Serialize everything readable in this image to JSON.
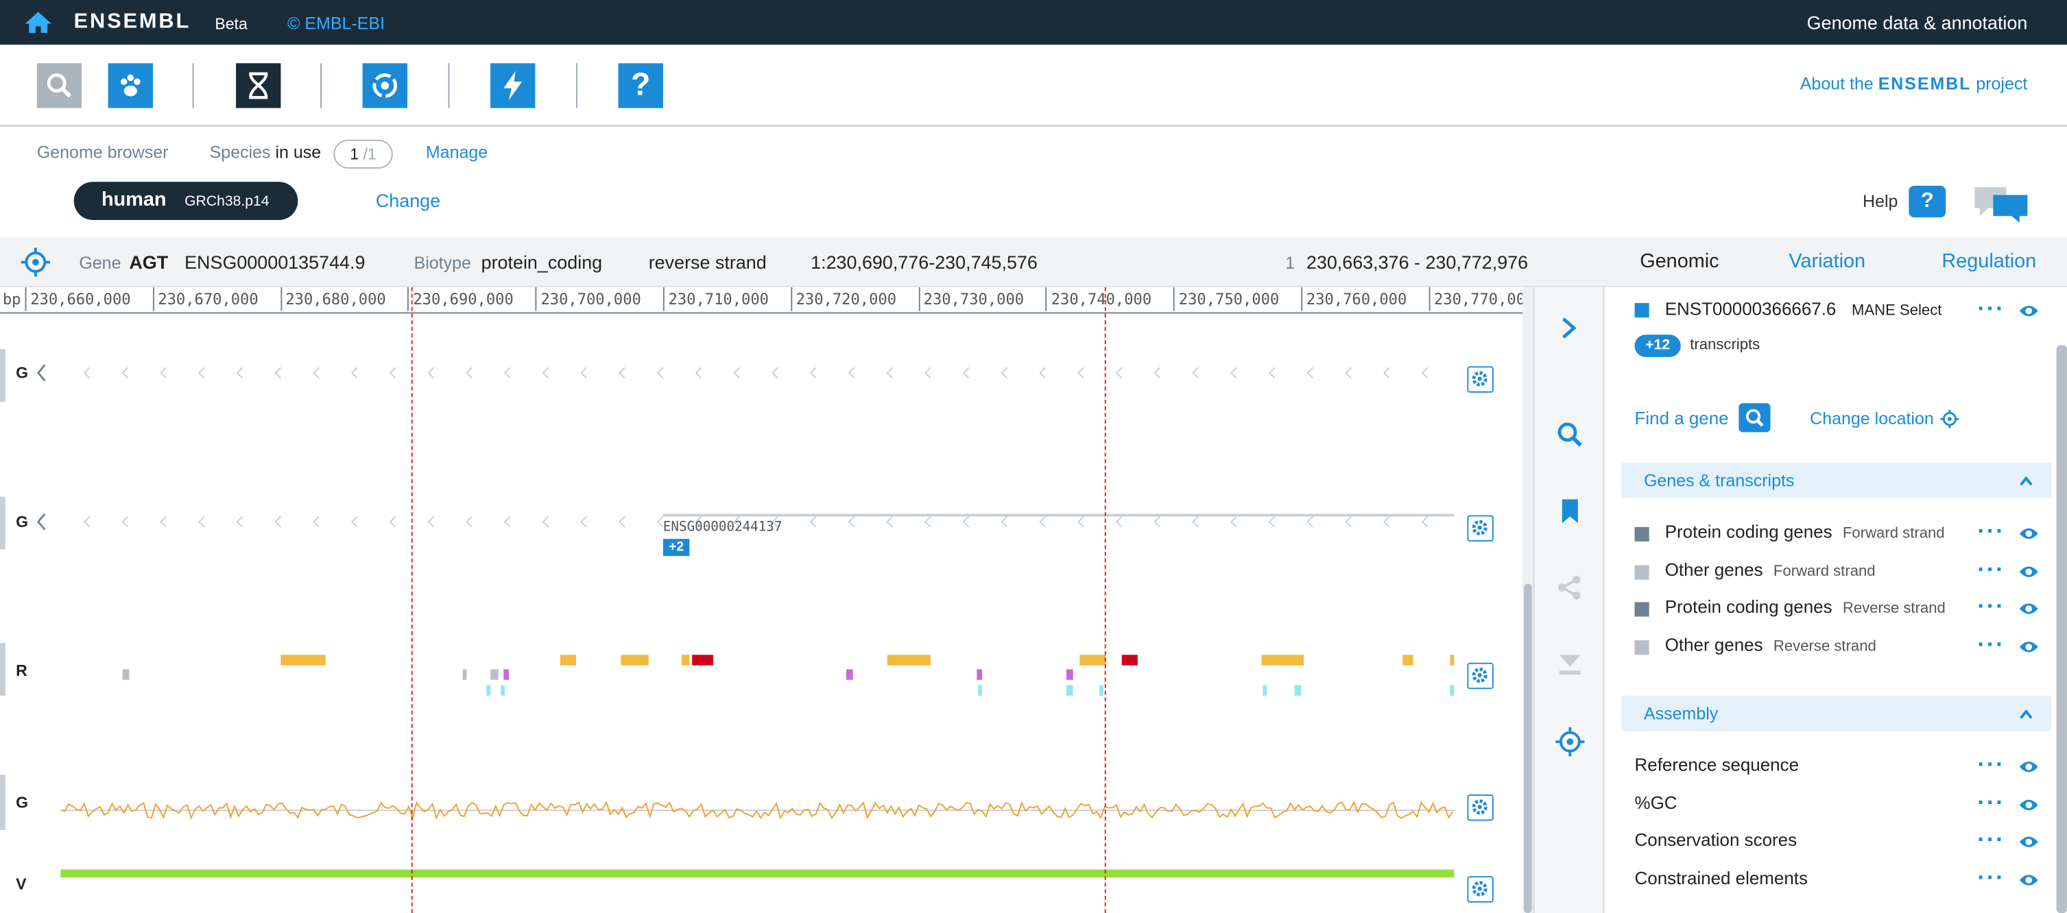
{
  "header": {
    "brand": "ENSEMBL",
    "beta": "Beta",
    "copyright": "© EMBL-EBI",
    "tagline": "Genome data & annotation"
  },
  "launcher": {
    "about_prefix": "About the",
    "about_brand": "ENSEMBL",
    "about_suffix": "project",
    "icons": [
      "search-icon",
      "species-icon",
      "genome-browser-icon",
      "entity-viewer-icon",
      "tools-icon",
      "help-icon"
    ]
  },
  "species_bar": {
    "genome_browser": "Genome browser",
    "species_label": "Species",
    "in_use": "in use",
    "count_current": "1",
    "count_total": "/1",
    "manage": "Manage",
    "species_name": "human",
    "assembly": "GRCh38.p14",
    "change": "Change",
    "help": "Help",
    "help_icon": "?"
  },
  "gene_bar": {
    "gene_label": "Gene",
    "gene_symbol": "AGT",
    "gene_id": "ENSG00000135744.9",
    "biotype_label": "Biotype",
    "biotype": "protein_coding",
    "strand": "reverse strand",
    "location": "1:230,690,776-230,745,576",
    "chr": "1",
    "viewport": "230,663,376 - 230,772,976",
    "tabs": [
      "Genomic",
      "Variation",
      "Regulation"
    ]
  },
  "ruler": {
    "unit": "bp",
    "ticks": [
      "230,660,000",
      "230,670,000",
      "230,680,000",
      "230,690,000",
      "230,700,000",
      "230,710,000",
      "230,720,000",
      "230,730,000",
      "230,740,000",
      "230,750,000",
      "230,760,000",
      "230,770,000"
    ]
  },
  "tracks": {
    "labels": [
      "G",
      "G",
      "R",
      "G",
      "V"
    ],
    "gene_feature_label": "ENSG00000244137",
    "gene_feature_badge": "+2"
  },
  "panel": {
    "transcript_id": "ENST00000366667.6",
    "transcript_tag": "MANE Select",
    "more_badge": "+12",
    "more_text": "transcripts",
    "find_gene": "Find a gene",
    "change_location": "Change location",
    "sections": [
      {
        "title": "Genes & transcripts",
        "items": [
          {
            "label": "Protein coding genes",
            "sub": "Forward strand",
            "color": "#6f8190"
          },
          {
            "label": "Other genes",
            "sub": "Forward strand",
            "color": "#b7c0c8"
          },
          {
            "label": "Protein coding genes",
            "sub": "Reverse strand",
            "color": "#6f8190"
          },
          {
            "label": "Other genes",
            "sub": "Reverse strand",
            "color": "#b7c0c8"
          }
        ]
      },
      {
        "title": "Assembly",
        "items": [
          {
            "label": "Reference sequence"
          },
          {
            "label": "%GC"
          },
          {
            "label": "Conservation scores"
          },
          {
            "label": "Constrained elements"
          }
        ]
      }
    ]
  },
  "colors": {
    "dark": "#1b2c39",
    "blue": "#1b8bd8",
    "highlight": "#e02020",
    "gc_line": "#f0a030",
    "variation": "#8fe03a"
  }
}
